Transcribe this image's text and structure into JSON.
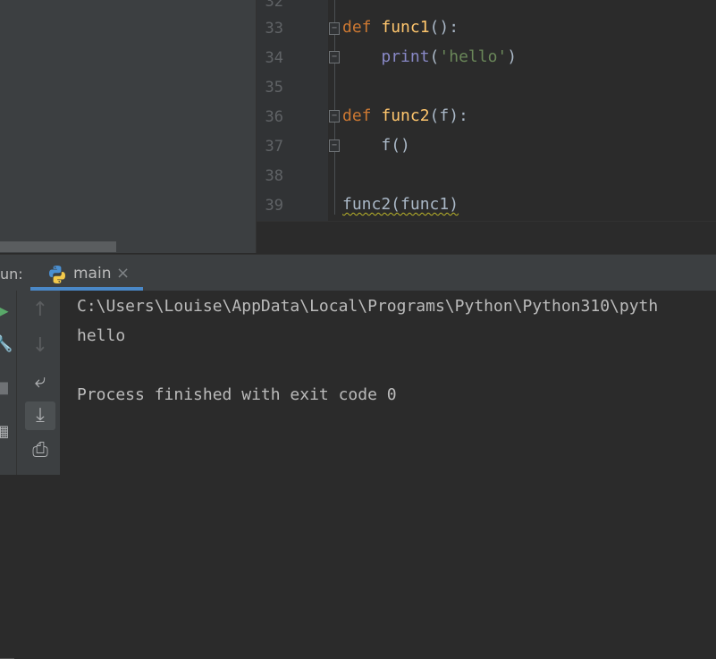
{
  "editor": {
    "lines": [
      {
        "number": "33",
        "code_kw": "def",
        "code_fn": "func1",
        "code_rest": "():"
      },
      {
        "number": "34",
        "indent": "    ",
        "builtin": "print",
        "open": "(",
        "str": "'hello'",
        "close": ")"
      },
      {
        "number": "35"
      },
      {
        "number": "36",
        "code_kw": "def",
        "code_fn": "func2",
        "code_rest": "(f):"
      },
      {
        "number": "37",
        "indent": "    ",
        "plain": "f()"
      },
      {
        "number": "38"
      },
      {
        "number": "39",
        "plain": "func2(func1)"
      }
    ]
  },
  "run_window": {
    "label": "un:",
    "tab_name": "main",
    "tab_close": "×",
    "console_lines": [
      "C:\\Users\\Louise\\AppData\\Local\\Programs\\Python\\Python310\\pyth",
      "hello",
      "",
      "Process finished with exit code 0"
    ]
  },
  "icons": {
    "rerun": "play-icon",
    "settings": "wrench-icon",
    "stop": "stop-icon",
    "layout": "layout-icon",
    "up": "arrow-up-icon",
    "down": "arrow-down-icon",
    "wrap": "soft-wrap-icon",
    "scroll_end": "scroll-to-end-icon",
    "print": "print-icon"
  },
  "colors": {
    "keyword": "#cc7832",
    "function": "#ffc66d",
    "builtin": "#8888c6",
    "string": "#6a8759",
    "accent": "#4a88c7"
  }
}
